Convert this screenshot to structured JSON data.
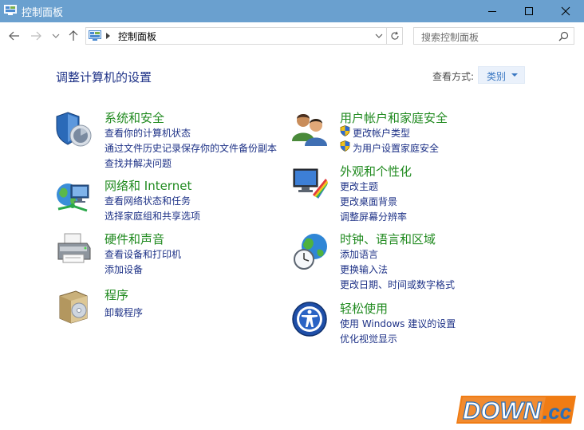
{
  "window": {
    "title": "控制面板",
    "controls": [
      "minimize",
      "maximize",
      "close"
    ]
  },
  "nav": {
    "back_icon": "arrow-left-icon",
    "forward_icon": "arrow-right-icon",
    "recent_icon": "chevron-down-icon",
    "up_icon": "arrow-up-icon",
    "address": "控制面板",
    "search_placeholder": "搜索控制面板"
  },
  "main": {
    "heading": "调整计算机的设置",
    "view_by_label": "查看方式:",
    "view_by_value": "类别"
  },
  "categories": {
    "system": {
      "title": "系统和安全",
      "links": [
        "查看你的计算机状态",
        "通过文件历史记录保存你的文件备份副本",
        "查找并解决问题"
      ]
    },
    "network": {
      "title": "网络和 Internet",
      "links": [
        "查看网络状态和任务",
        "选择家庭组和共享选项"
      ]
    },
    "hardware": {
      "title": "硬件和声音",
      "links": [
        "查看设备和打印机",
        "添加设备"
      ]
    },
    "programs": {
      "title": "程序",
      "links": [
        "卸载程序"
      ]
    },
    "users": {
      "title": "用户帐户和家庭安全",
      "links": [
        "更改帐户类型",
        "为用户设置家庭安全"
      ]
    },
    "appearance": {
      "title": "外观和个性化",
      "links": [
        "更改主题",
        "更改桌面背景",
        "调整屏幕分辨率"
      ]
    },
    "clock": {
      "title": "时钟、语言和区域",
      "links": [
        "添加语言",
        "更换输入法",
        "更改日期、时间或数字格式"
      ]
    },
    "ease": {
      "title": "轻松使用",
      "links": [
        "使用 Windows 建议的设置",
        "优化视觉显示"
      ]
    }
  },
  "watermark": {
    "text_main": "DOWN",
    "text_suffix": ".cc"
  },
  "colors": {
    "titlebar": "#6aa0cf",
    "category_title": "#208a1f",
    "link": "#1e3287",
    "watermark_bg": "#f07c14",
    "watermark_text": "#2d6fb5"
  }
}
